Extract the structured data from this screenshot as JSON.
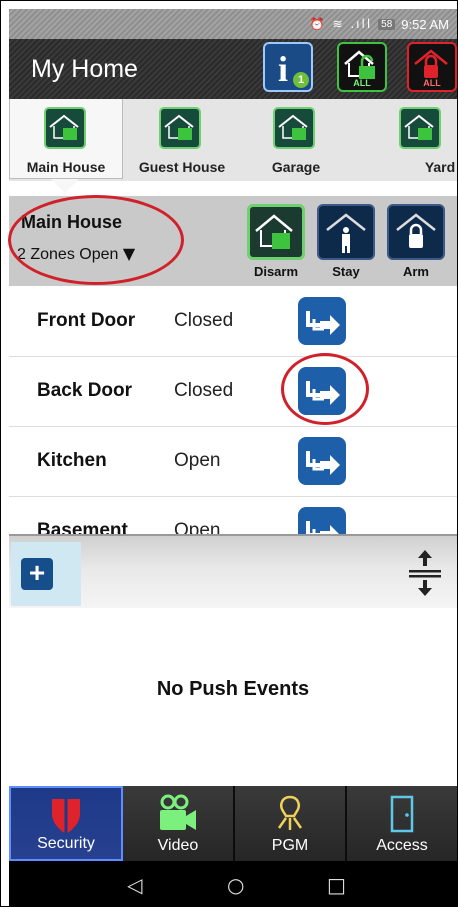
{
  "status_bar": {
    "battery": "58",
    "time": "9:52 AM",
    "icons": [
      "alarm-icon",
      "wifi-icon",
      "signal-icon"
    ]
  },
  "header": {
    "title": "My Home",
    "info_badge": "1",
    "disarm_all_label": "ALL",
    "arm_all_label": "ALL"
  },
  "locations": [
    {
      "label": "Main House",
      "active": true
    },
    {
      "label": "Guest House",
      "active": false
    },
    {
      "label": "Garage",
      "active": false
    },
    {
      "label": "Yard",
      "active": false
    }
  ],
  "arm_panel": {
    "location_name": "Main House",
    "zones_open": "2 Zones Open",
    "buttons": [
      {
        "label": "Disarm",
        "selected": true
      },
      {
        "label": "Stay",
        "selected": false
      },
      {
        "label": "Arm",
        "selected": false
      }
    ]
  },
  "zones": [
    {
      "name": "Front Door",
      "status": "Closed"
    },
    {
      "name": "Back Door",
      "status": "Closed"
    },
    {
      "name": "Kitchen",
      "status": "Open"
    },
    {
      "name": "Basement",
      "status": "Open"
    }
  ],
  "push": {
    "empty_message": "No Push Events"
  },
  "bottom_nav": [
    {
      "label": "Security",
      "icon": "shield-icon",
      "active": true
    },
    {
      "label": "Video",
      "icon": "camera-icon",
      "active": false
    },
    {
      "label": "PGM",
      "icon": "bulb-icon",
      "active": false
    },
    {
      "label": "Access",
      "icon": "door-icon",
      "active": false
    }
  ],
  "colors": {
    "disarm_green": "#6fd06f",
    "arm_red": "#e0232b",
    "brand_blue": "#1d5fa8",
    "annotation_red": "#d0202a"
  }
}
